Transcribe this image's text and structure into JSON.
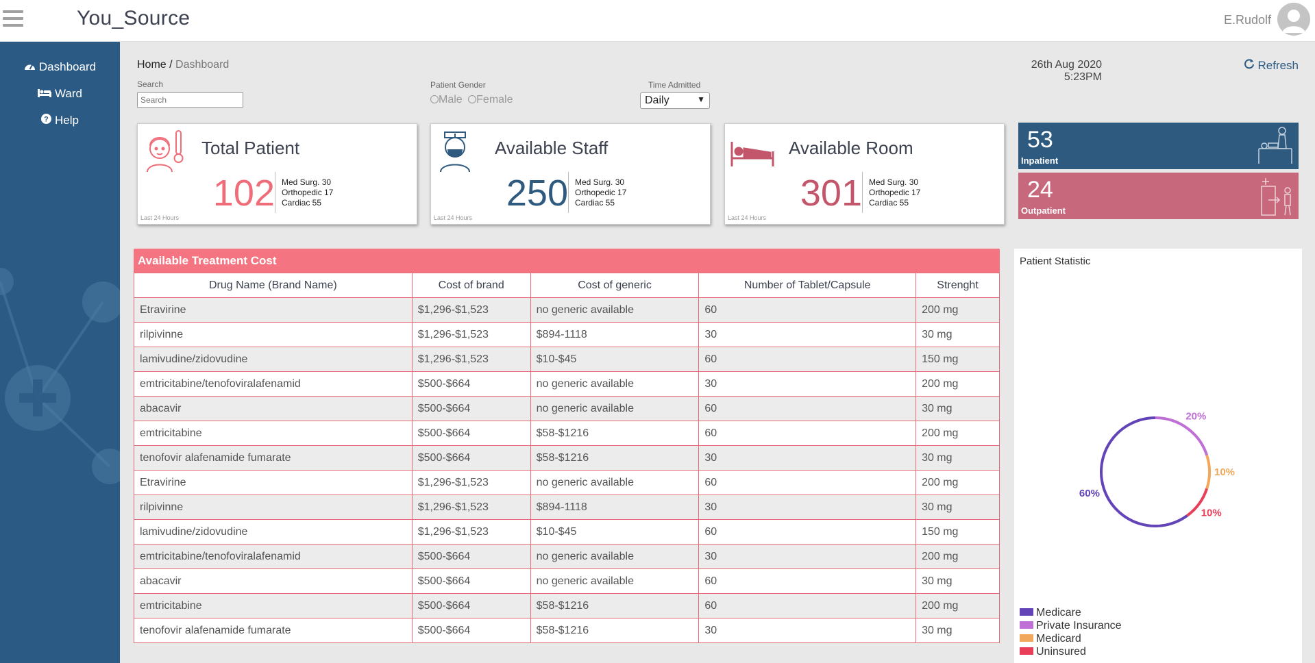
{
  "app": {
    "brand": "You_Source",
    "user": "E.Rudolf"
  },
  "sidebar": {
    "items": [
      {
        "label": "Dashboard",
        "icon": "tachometer-icon"
      },
      {
        "label": "Ward",
        "icon": "bed-icon"
      },
      {
        "label": "Help",
        "icon": "question-circle-icon"
      }
    ]
  },
  "breadcrumb": {
    "home": "Home",
    "separator": " / ",
    "current": "Dashboard"
  },
  "filters": {
    "search_label": "Search",
    "search_placeholder": "Search",
    "search_value": "",
    "gender_label": "Patient Gender",
    "gender_options": [
      "Male",
      "Female"
    ],
    "time_label": "Time Admitted",
    "time_selected": "Daily"
  },
  "datetime": {
    "date": "26th Aug 2020",
    "time": "5:23PM"
  },
  "refresh_label": "Refresh",
  "cards": [
    {
      "title": "Total Patient",
      "value": "102",
      "lines": [
        "Med Surg. 30",
        "Orthopedic 17",
        "Cardiac 55"
      ],
      "footer": "Last 24 Hours",
      "color": "#ee6d78"
    },
    {
      "title": "Available Staff",
      "value": "250",
      "lines": [
        "Med Surg. 30",
        "Orthopedic 17",
        "Cardiac 55"
      ],
      "footer": "Last 24 Hours",
      "color": "#2f5a80"
    },
    {
      "title": "Available Room",
      "value": "301",
      "lines": [
        "Med Surg. 30",
        "Orthopedic 17",
        "Cardiac 55"
      ],
      "footer": "Last 24 Hours",
      "color": "#c3566b"
    }
  ],
  "stats": {
    "inpatient": {
      "value": "53",
      "label": "Inpatient",
      "color": "#2f5a80"
    },
    "outpatient": {
      "value": "24",
      "label": "Outpatient",
      "color": "#c8687c"
    }
  },
  "treatment": {
    "title": "Available Treatment Cost",
    "columns": [
      "Drug Name (Brand Name)",
      "Cost of brand",
      "Cost of generic",
      "Number of Tablet/Capsule",
      "Strenght"
    ],
    "rows": [
      [
        "Etravirine",
        "$1,296-$1,523",
        "no generic available",
        "60",
        "200 mg"
      ],
      [
        "rilpivinne",
        "$1,296-$1,523",
        "$894-1118",
        "30",
        "30 mg"
      ],
      [
        "lamivudine/zidovudine",
        "$1,296-$1,523",
        "$10-$45",
        "60",
        "150 mg"
      ],
      [
        "emtricitabine/tenofoviralafenamid",
        "$500-$664",
        "no generic available",
        "30",
        "200 mg"
      ],
      [
        "abacavir",
        "$500-$664",
        "no generic available",
        "60",
        "30 mg"
      ],
      [
        "emtricitabine",
        "$500-$664",
        "$58-$1216",
        "60",
        "200 mg"
      ],
      [
        "tenofovir alafenamide fumarate",
        "$500-$664",
        "$58-$1216",
        "30",
        "30 mg"
      ],
      [
        "Etravirine",
        "$1,296-$1,523",
        "no generic available",
        "60",
        "200 mg"
      ],
      [
        "rilpivinne",
        "$1,296-$1,523",
        "$894-1118",
        "30",
        "30 mg"
      ],
      [
        "lamivudine/zidovudine",
        "$1,296-$1,523",
        "$10-$45",
        "60",
        "150 mg"
      ],
      [
        "emtricitabine/tenofoviralafenamid",
        "$500-$664",
        "no generic available",
        "30",
        "200 mg"
      ],
      [
        "abacavir",
        "$500-$664",
        "no generic available",
        "60",
        "30 mg"
      ],
      [
        "emtricitabine",
        "$500-$664",
        "$58-$1216",
        "60",
        "200 mg"
      ],
      [
        "tenofovir alafenamide fumarate",
        "$500-$664",
        "$58-$1216",
        "30",
        "30 mg"
      ]
    ]
  },
  "patient_statistic": {
    "title": "Patient Statistic",
    "segments": [
      {
        "name": "Medicare",
        "percent": 60,
        "label": "60%",
        "color": "#6243b8"
      },
      {
        "name": "Private Insurance",
        "percent": 20,
        "label": "20%",
        "color": "#c06fd6"
      },
      {
        "name": "Medicard",
        "percent": 10,
        "label": "10%",
        "color": "#f2a85c"
      },
      {
        "name": "Uninsured",
        "percent": 10,
        "label": "10%",
        "color": "#e83e57"
      }
    ]
  },
  "chart_data": {
    "type": "pie",
    "title": "Patient Statistic",
    "categories": [
      "Medicare",
      "Private Insurance",
      "Medicard",
      "Uninsured"
    ],
    "values": [
      60,
      20,
      10,
      10
    ],
    "legend": "bottom-left"
  }
}
